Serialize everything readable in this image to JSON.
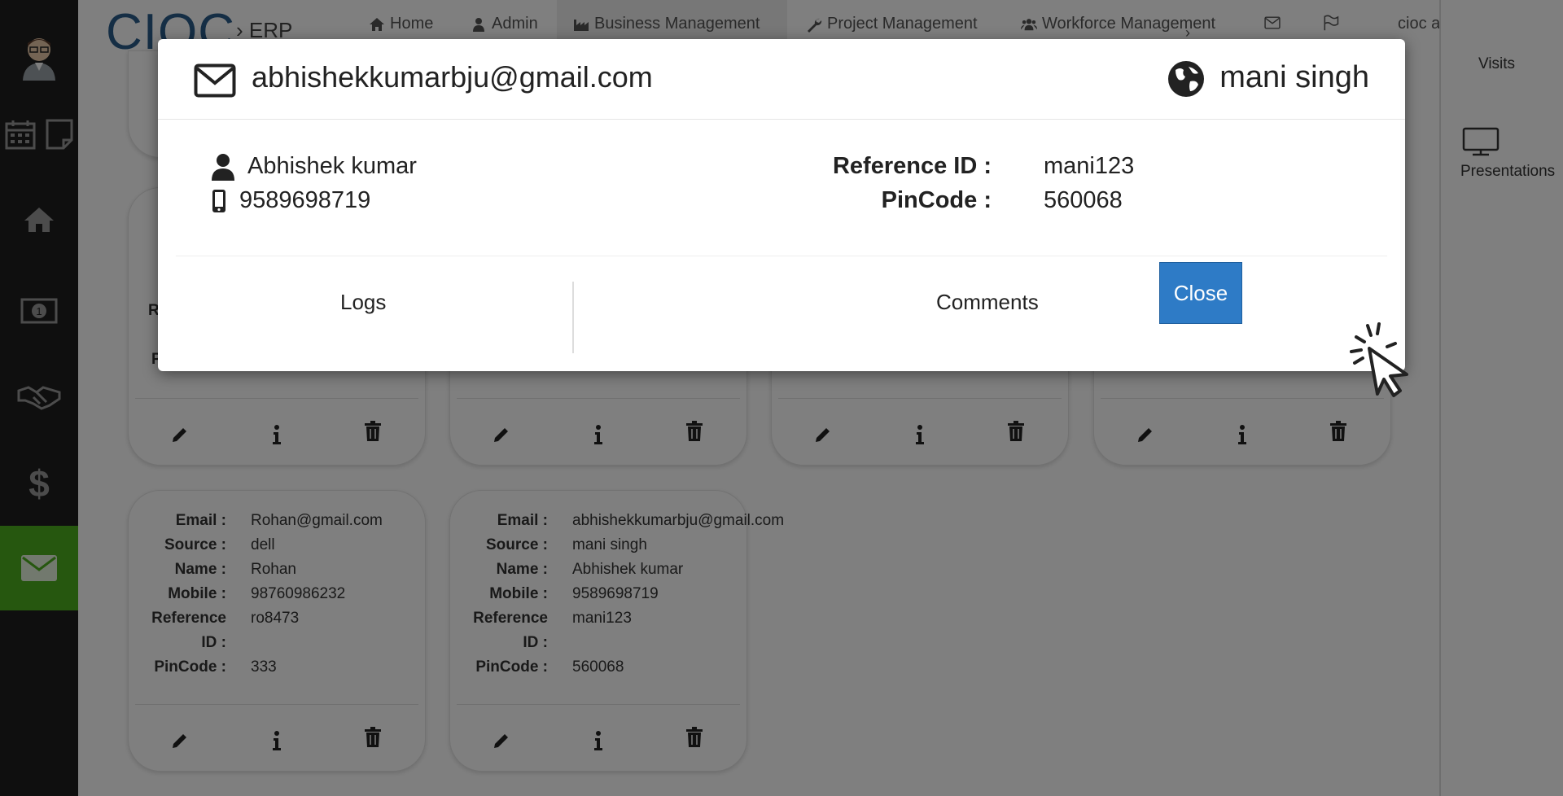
{
  "app": {
    "logo": "CIOC",
    "logo_sub": "ERP"
  },
  "nav": {
    "home": "Home",
    "admin": "Admin",
    "business": "Business Management",
    "project": "Project Management",
    "workforce": "Workforce Management",
    "user": "cioc admin"
  },
  "right_panel": {
    "visits": "Visits",
    "presentations": "Presentations"
  },
  "cards": [
    {
      "email_label": "Email :",
      "email": "Rohan@gmail.com",
      "source_label": "Source :",
      "source": "dell",
      "name_label": "Name :",
      "name": "Rohan",
      "mobile_label": "Mobile :",
      "mobile": "98760986232",
      "ref_label_1": "Reference",
      "ref_label_2": "ID :",
      "ref": "ro8473",
      "pin_label": "PinCode :",
      "pin": "333"
    },
    {
      "email_label": "Email :",
      "email": "abhishekkumarbju@gmail.com",
      "source_label": "Source :",
      "source": "mani singh",
      "name_label": "Name :",
      "name": "Abhishek kumar",
      "mobile_label": "Mobile :",
      "mobile": "9589698719",
      "ref_label_1": "Reference",
      "ref_label_2": "ID :",
      "ref": "mani123",
      "pin_label": "PinCode :",
      "pin": "560068"
    }
  ],
  "partial_card_labels": {
    "a": "R",
    "b": "P"
  },
  "modal": {
    "email": "abhishekkumarbju@gmail.com",
    "source": "mani singh",
    "name": "Abhishek kumar",
    "mobile": "9589698719",
    "ref_label": "Reference ID :",
    "ref": "mani123",
    "pin_label": "PinCode :",
    "pin": "560068",
    "tab_logs": "Logs",
    "tab_comments": "Comments",
    "close": "Close"
  }
}
